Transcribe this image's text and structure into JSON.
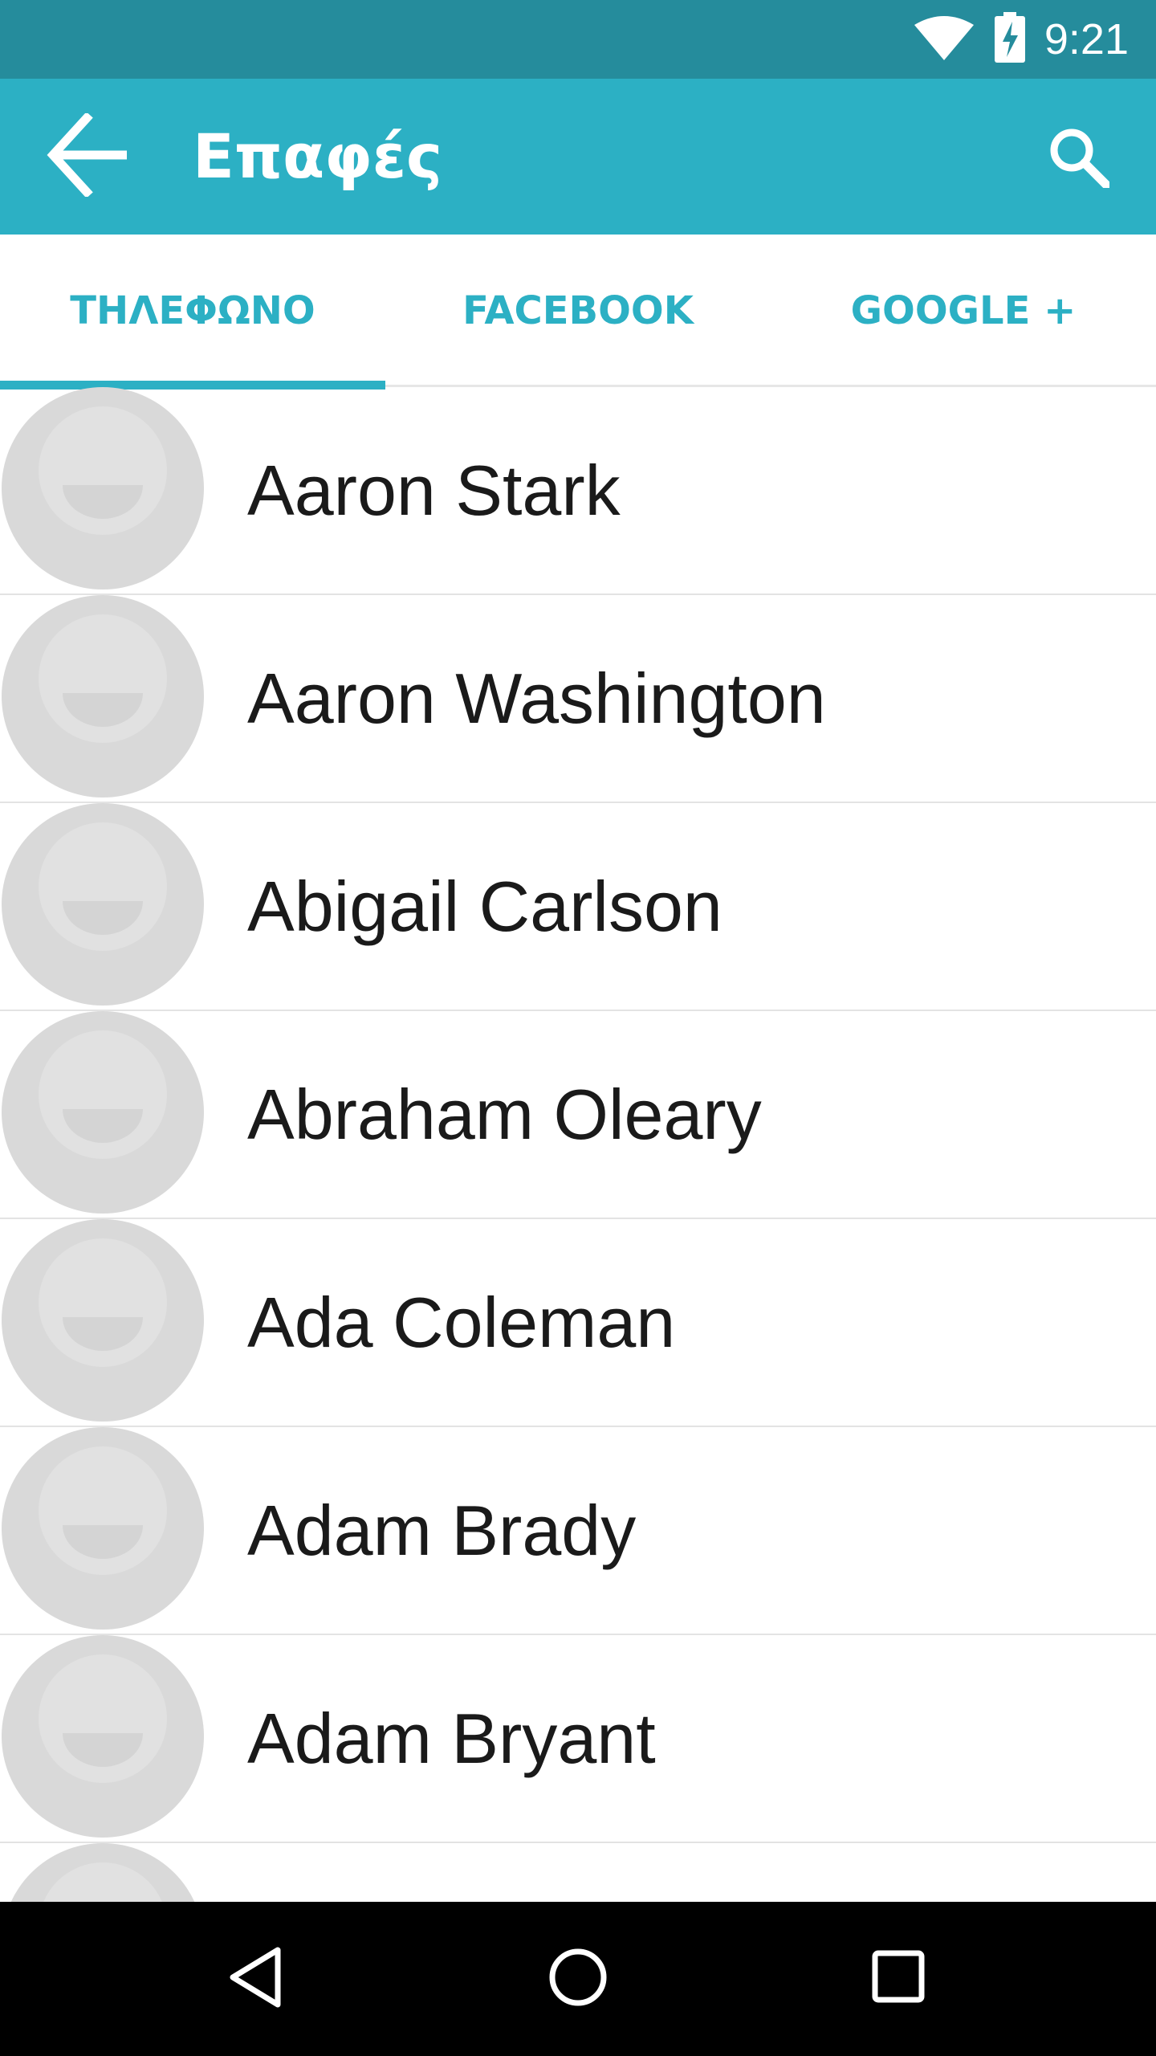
{
  "status_bar": {
    "time": "9:21",
    "icons": [
      "wifi-icon",
      "battery-charging-icon"
    ]
  },
  "app_bar": {
    "title": "Επαφές",
    "icons": [
      "back-arrow-icon",
      "search-icon"
    ]
  },
  "tabs": [
    {
      "label": "ΤΗΛΕΦΩΝΟ",
      "selected": true
    },
    {
      "label": "FACEBOOK",
      "selected": false
    },
    {
      "label": "GOOGLE +",
      "selected": false
    }
  ],
  "contacts": [
    {
      "name": "Aaron Stark"
    },
    {
      "name": "Aaron Washington"
    },
    {
      "name": "Abigail Carlson"
    },
    {
      "name": "Abraham Oleary"
    },
    {
      "name": "Ada Coleman"
    },
    {
      "name": "Adam Brady"
    },
    {
      "name": "Adam Bryant"
    },
    {
      "name": ""
    }
  ],
  "nav_bar": {
    "icons": [
      "nav-back-icon",
      "nav-home-icon",
      "nav-recents-icon"
    ]
  },
  "colors": {
    "status_bar": "#258c9c",
    "app_bar": "#2cb0c4",
    "accent": "#2cb0c4"
  }
}
